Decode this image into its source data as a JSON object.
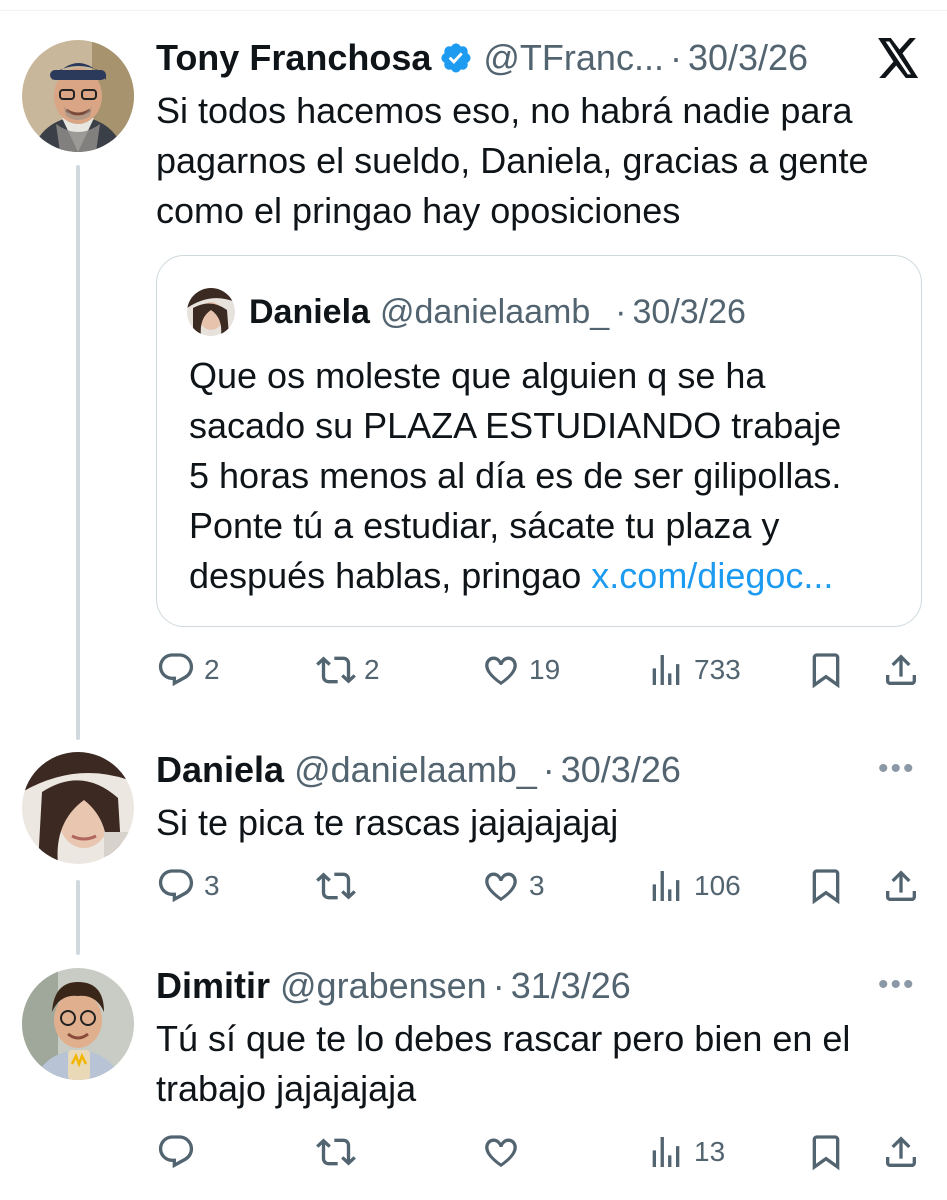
{
  "platform": {
    "logo_name": "x-logo"
  },
  "tweet_main": {
    "author_name": "Tony Franchosa",
    "handle": "@TFranc...",
    "separator": "·",
    "date": "30/3/26",
    "text_lines": [
      "Si todos hacemos eso, no habrá nadie para",
      "pagarnos el sueldo, Daniela, gracias a gente",
      "como el pringao hay oposiciones"
    ],
    "verified_icon": "verified-badge-icon",
    "quote": {
      "author_name": "Daniela",
      "handle": "@danielaamb_",
      "separator": "·",
      "date": "30/3/26",
      "text_lines": [
        "Que os moleste que alguien q se ha",
        "sacado su PLAZA ESTUDIANDO trabaje",
        "5 horas menos al día es de ser gilipollas.",
        "Ponte tú a estudiar, sácate tu plaza y"
      ],
      "last_line_text": "después hablas, pringao ",
      "link": "x.com/diegoc..."
    },
    "actions": {
      "replies": "2",
      "reposts": "2",
      "likes": "19",
      "views": "733"
    }
  },
  "reply_1": {
    "author_name": "Daniela",
    "handle": "@danielaamb_",
    "separator": "·",
    "date": "30/3/26",
    "text_lines": [
      "Si te pica te rascas jajajajajaj"
    ],
    "more": "•••",
    "actions": {
      "replies": "3",
      "reposts": "",
      "likes": "3",
      "views": "106"
    }
  },
  "reply_2": {
    "author_name": "Dimitir",
    "handle": "@grabensen",
    "separator": "·",
    "date": "31/3/26",
    "text_lines": [
      "Tú sí que te lo debes rascar pero bien en el",
      "trabajo jajajajaja"
    ],
    "more": "•••",
    "actions": {
      "replies": "",
      "reposts": "",
      "likes": "",
      "views": "13"
    }
  },
  "icons": [
    "reply-icon",
    "repost-icon",
    "like-icon",
    "views-icon",
    "bookmark-icon",
    "share-icon",
    "more-icon"
  ],
  "colors": {
    "text": "#0f1419",
    "secondary": "#536471",
    "link": "#1d9bf0",
    "verified": "#1d9bf0",
    "border": "#cfd9de"
  }
}
